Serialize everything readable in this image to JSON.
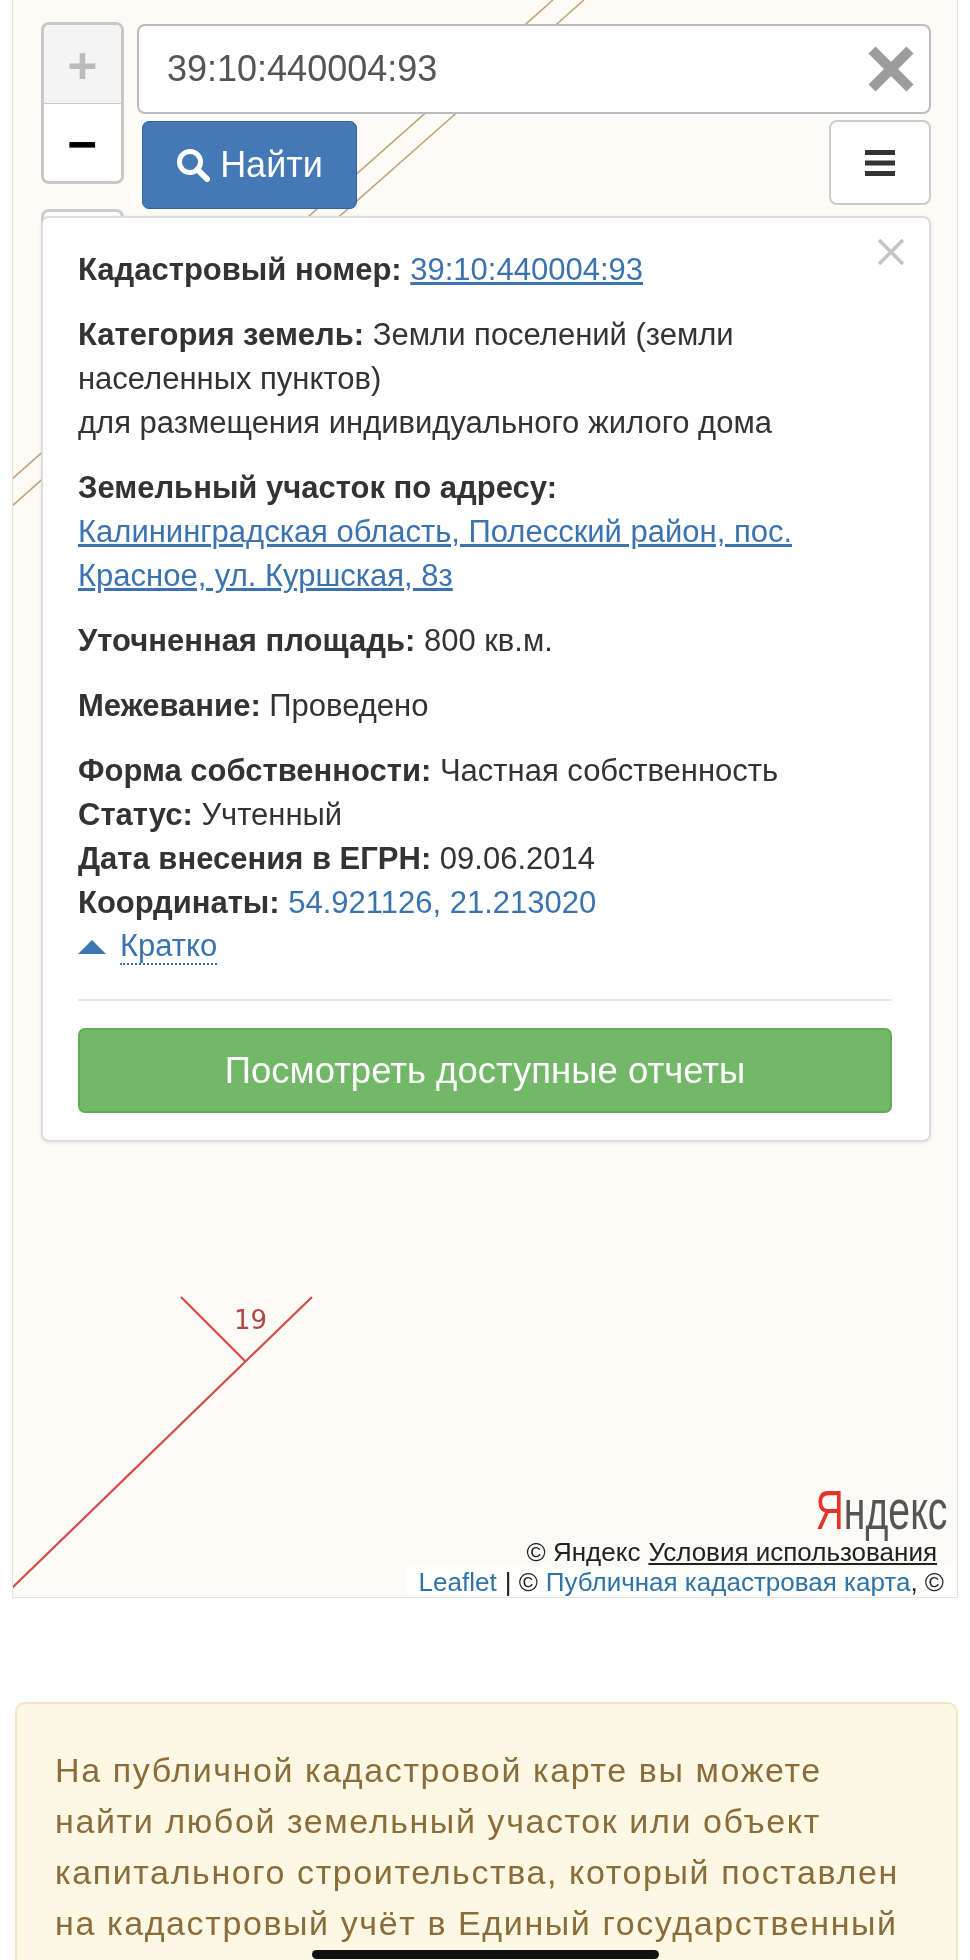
{
  "map": {
    "zoom": [
      {
        "label": "+",
        "disabled": true
      },
      {
        "label": "−",
        "disabled": false
      }
    ],
    "search": {
      "value": "39:10:440004:93",
      "button": "Найти"
    },
    "popup": {
      "sections": [
        {
          "rows": [
            {
              "kind": "link",
              "label": "Кадастровый номер:",
              "value": "39:10:440004:93"
            }
          ]
        },
        {
          "rows": [
            {
              "kind": "text",
              "label": "Категория земель:",
              "value": "Земли поселений (земли населенных пунктов)"
            },
            {
              "kind": "note",
              "value": "для размещения индивидуального жилого дома"
            }
          ]
        },
        {
          "rows": [
            {
              "kind": "link",
              "label": "Земельный участок по адресу:",
              "value": "Калининградская область, Полесский район, пос. Красное, ул. Куршская, 8з"
            }
          ]
        },
        {
          "rows": [
            {
              "kind": "text",
              "label": "Уточненная площадь:",
              "value": "800 кв.м."
            }
          ]
        },
        {
          "rows": [
            {
              "kind": "text",
              "label": "Межевание:",
              "value": "Проведено"
            }
          ]
        },
        {
          "rows": [
            {
              "kind": "text",
              "label": "Форма собственности:",
              "value": "Частная собственность"
            },
            {
              "kind": "text",
              "label": "Статус:",
              "value": "Учтенный"
            },
            {
              "kind": "text",
              "label": "Дата внесения в ЕГРН:",
              "value": "09.06.2014"
            },
            {
              "kind": "coords",
              "label": "Координаты:",
              "value": "54.921126, 21.213020"
            }
          ]
        }
      ],
      "details_toggle": {
        "label": "Кратко",
        "expanded": true
      },
      "report_button": "Посмотреть доступные отчеты"
    },
    "parcel_number": "19",
    "provider_logo": "Яндекс",
    "attributions": [
      {
        "kind": "plain",
        "items": [
          {
            "kind": "text",
            "text": "© Яндекс"
          },
          {
            "kind": "link",
            "text": "Условия использования"
          }
        ]
      },
      {
        "kind": "bar",
        "items": [
          {
            "kind": "link",
            "text": "Leaflet"
          },
          {
            "kind": "text",
            "text": "| ©"
          },
          {
            "kind": "link",
            "text": "Публичная кадастровая карта"
          },
          {
            "kind": "suffix",
            "text": ", ©"
          }
        ]
      }
    ]
  },
  "notice": {
    "text": "На публичной кадастровой карте вы можете найти любой земельный участок или объект капитального строительства, который поставлен на кадастровый учёт в Единый государственный"
  }
}
